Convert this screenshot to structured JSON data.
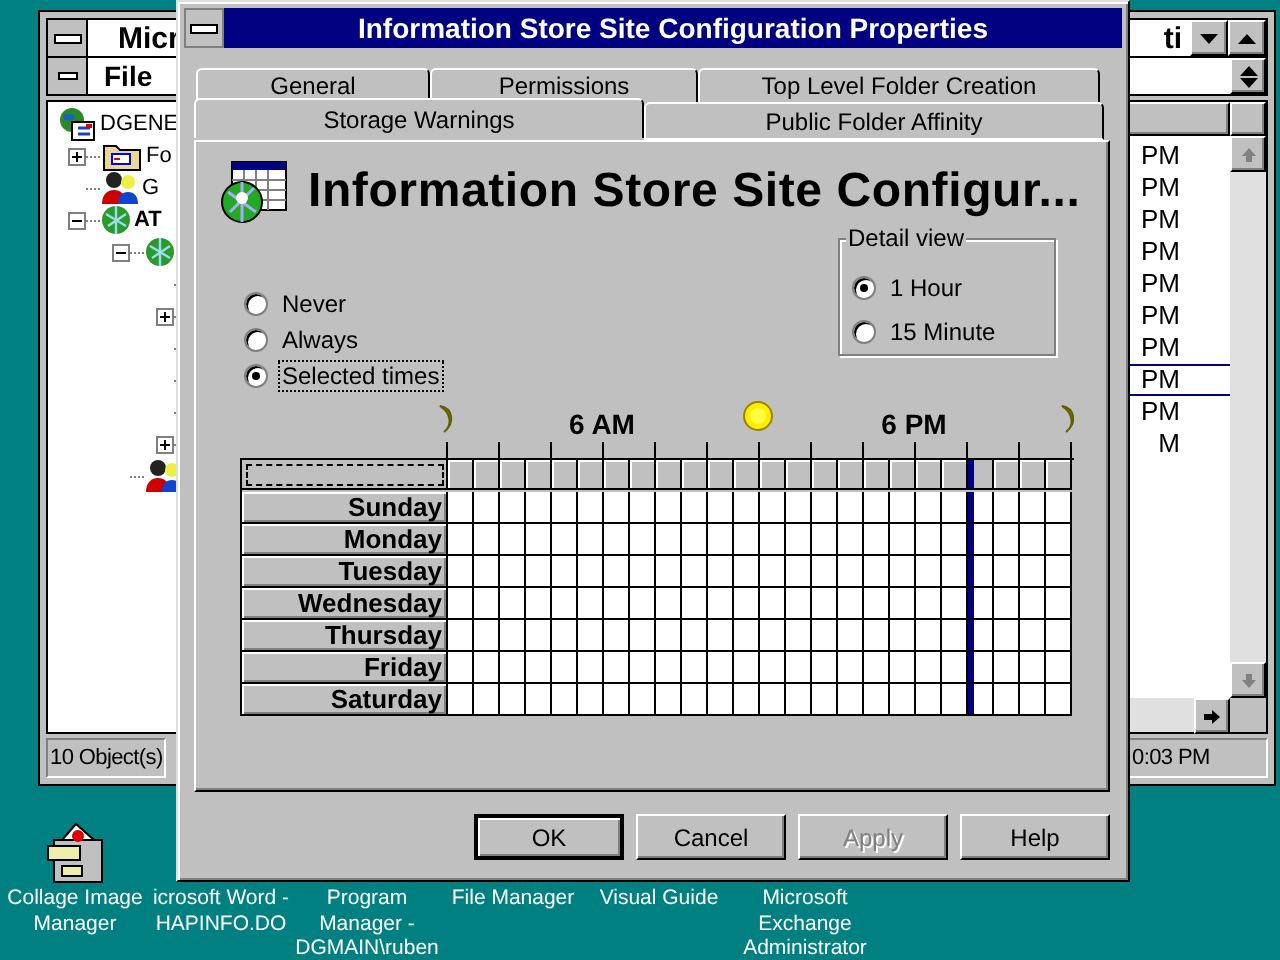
{
  "background_window": {
    "title_left": "Micr",
    "title_right": "ti",
    "menu": [
      {
        "label": "File"
      }
    ],
    "tree": [
      {
        "label": "DGENE",
        "bold": false,
        "kind": "site",
        "children": [
          {
            "label": "Fo",
            "bold": false,
            "kind": "folders",
            "expanded": false
          },
          {
            "label": "G",
            "bold": false,
            "kind": "person"
          },
          {
            "label": "AT",
            "bold": true,
            "kind": "globe",
            "expanded": true,
            "children": [
              {
                "kind": "globe",
                "expanded": true,
                "children": [
                  {
                    "kind": "leaf"
                  },
                  {
                    "expanded": false
                  },
                  {
                    "kind": "leaf"
                  },
                  {
                    "kind": "leaf"
                  },
                  {
                    "kind": "leaf"
                  },
                  {
                    "expanded": false
                  }
                ]
              },
              {
                "kind": "person"
              }
            ]
          }
        ]
      }
    ],
    "list_rows": [
      {
        "text": "PM",
        "selected": false
      },
      {
        "text": "PM",
        "selected": false
      },
      {
        "text": "PM",
        "selected": false
      },
      {
        "text": "PM",
        "selected": false
      },
      {
        "text": "PM",
        "selected": false
      },
      {
        "text": "PM",
        "selected": false
      },
      {
        "text": "PM",
        "selected": false
      },
      {
        "text": "PM",
        "selected": true
      },
      {
        "text": "PM",
        "selected": false
      },
      {
        "text": "M",
        "selected": false
      }
    ],
    "status_bar": {
      "left": "10 Object(s)",
      "right": "0:03 PM"
    }
  },
  "dialog": {
    "title": "Information Store Site Configuration Properties",
    "tab_rows": [
      {
        "tabs": [
          {
            "label": "General",
            "selected": false
          },
          {
            "label": "Permissions",
            "selected": false
          },
          {
            "label": "Top Level Folder Creation",
            "selected": false
          }
        ]
      },
      {
        "tabs": [
          {
            "label": "Storage Warnings",
            "selected": true
          },
          {
            "label": "Public Folder Affinity",
            "selected": false
          }
        ]
      }
    ],
    "heading": "Information Store Site Configur...",
    "options": [
      {
        "label": "Never",
        "selected": false,
        "focused": false
      },
      {
        "label": "Always",
        "selected": false,
        "focused": false
      },
      {
        "label": "Selected times",
        "selected": true,
        "focused": true
      }
    ],
    "detail_view": {
      "title": "Detail view",
      "options": [
        {
          "label": "1 Hour",
          "selected": true
        },
        {
          "label": "15 Minute",
          "selected": false
        }
      ]
    },
    "schedule": {
      "marks": [
        "6 AM",
        "6 PM"
      ],
      "days": [
        "Sunday",
        "Monday",
        "Tuesday",
        "Wednesday",
        "Thursday",
        "Friday",
        "Saturday"
      ],
      "hour_columns": [
        {
          "selected": false
        },
        {
          "selected": false
        },
        {
          "selected": false
        },
        {
          "selected": false
        },
        {
          "selected": false
        },
        {
          "selected": false
        },
        {
          "selected": false
        },
        {
          "selected": false
        },
        {
          "selected": false
        },
        {
          "selected": false
        },
        {
          "selected": false
        },
        {
          "selected": false
        },
        {
          "selected": false
        },
        {
          "selected": false
        },
        {
          "selected": false
        },
        {
          "selected": false
        },
        {
          "selected": false
        },
        {
          "selected": false
        },
        {
          "selected": false
        },
        {
          "selected": false
        },
        {
          "selected": true
        },
        {
          "selected": false
        },
        {
          "selected": false
        },
        {
          "selected": false
        }
      ]
    },
    "buttons": [
      {
        "label": "OK",
        "default": true,
        "disabled": false
      },
      {
        "label": "Cancel",
        "default": false,
        "disabled": false
      },
      {
        "label": "Apply",
        "default": false,
        "disabled": true
      },
      {
        "label": "Help",
        "default": false,
        "disabled": false
      }
    ]
  },
  "desktop_icons": [
    {
      "lines": [
        "Collage Image",
        "Manager"
      ],
      "kind": "cabinet"
    },
    {
      "lines": [
        "icrosoft Word -",
        "HAPINFO.DO"
      ]
    },
    {
      "lines": [
        "Program",
        "Manager -",
        "DGMAIN\\ruben"
      ]
    },
    {
      "lines": [
        "File Manager"
      ]
    },
    {
      "lines": [
        "Visual Guide"
      ]
    },
    {
      "lines": [
        "Microsoft",
        "Exchange",
        "Administrator"
      ]
    }
  ]
}
